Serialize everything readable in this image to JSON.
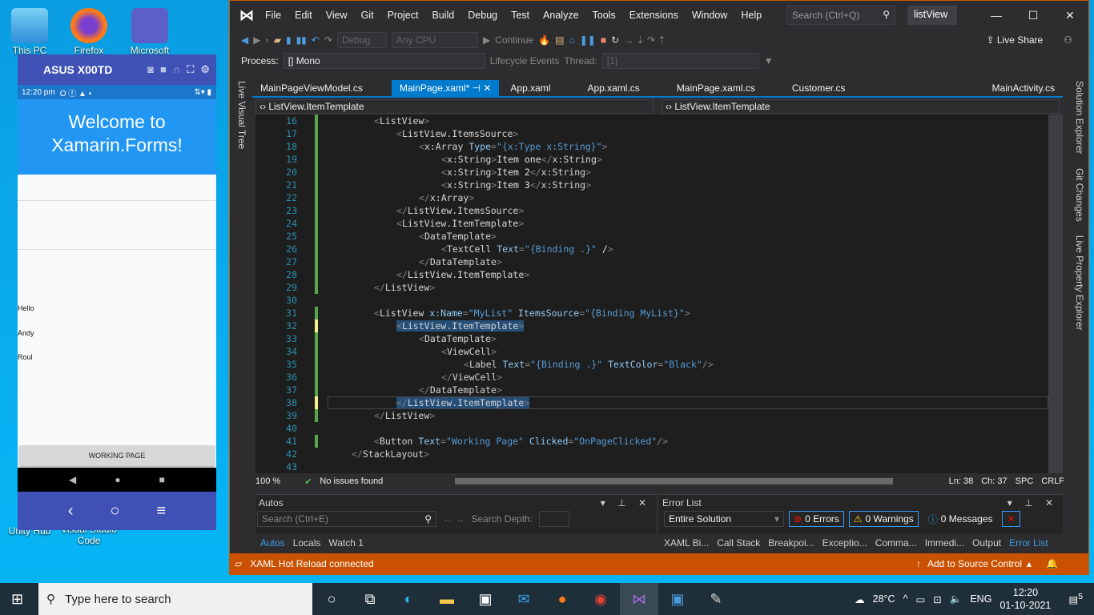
{
  "desktop": {
    "icons": [
      {
        "label": "This PC"
      },
      {
        "label": "Firefox"
      },
      {
        "label": "Microsoft"
      },
      {
        "label": "Unity Hub"
      },
      {
        "label": "Visual Studio Code"
      }
    ]
  },
  "emulator": {
    "device_name": "ASUS X00TD",
    "status_time": "12:20 pm",
    "banner_text_1": "Welcome to",
    "banner_text_2": "Xamarin.Forms!",
    "list_items": [
      "Hello",
      "Andy",
      "Roul"
    ],
    "button_label": "WORKING PAGE"
  },
  "vs": {
    "menu": [
      "File",
      "Edit",
      "View",
      "Git",
      "Project",
      "Build",
      "Debug",
      "Test",
      "Analyze",
      "Tools",
      "Extensions",
      "Window",
      "Help"
    ],
    "search_placeholder": "Search (Ctrl+Q)",
    "solution_name": "listView",
    "config": "Debug",
    "platform": "Any CPU",
    "continue_label": "Continue",
    "live_share": "Live Share",
    "process_label": "Process:",
    "process_value": "[] Mono",
    "lifecycle": "Lifecycle Events",
    "thread_label": "Thread:",
    "thread_value": "[1]",
    "tabs": [
      {
        "label": "MainPageViewModel.cs",
        "active": false
      },
      {
        "label": "MainPage.xaml*",
        "active": true
      },
      {
        "label": "App.xaml",
        "active": false
      },
      {
        "label": "App.xaml.cs",
        "active": false
      },
      {
        "label": "MainPage.xaml.cs",
        "active": false
      },
      {
        "label": "Customer.cs",
        "active": false
      },
      {
        "label": "MainActivity.cs",
        "active": false
      }
    ],
    "nav_left": "ListView.ItemTemplate",
    "nav_right": "ListView.ItemTemplate",
    "left_sidebar": "Live Visual Tree",
    "right_sidebar": [
      "Solution Explorer",
      "Git Changes",
      "Live Property Explorer"
    ],
    "code_lines": [
      {
        "n": "16",
        "text": "<ListView>"
      },
      {
        "n": "17",
        "text": "<ListView.ItemsSource>"
      },
      {
        "n": "18",
        "text": "<x:Array Type=\"{x:Type x:String}\">"
      },
      {
        "n": "19",
        "text": "<x:String>Item one</x:String>"
      },
      {
        "n": "20",
        "text": "<x:String>Item 2</x:String>"
      },
      {
        "n": "21",
        "text": "<x:String>Item 3</x:String>"
      },
      {
        "n": "22",
        "text": "</x:Array>"
      },
      {
        "n": "23",
        "text": "</ListView.ItemsSource>"
      },
      {
        "n": "24",
        "text": "<ListView.ItemTemplate>"
      },
      {
        "n": "25",
        "text": "<DataTemplate>"
      },
      {
        "n": "26",
        "text": "<TextCell Text=\"{Binding .}\" />"
      },
      {
        "n": "27",
        "text": "</DataTemplate>"
      },
      {
        "n": "28",
        "text": "</ListView.ItemTemplate>"
      },
      {
        "n": "29",
        "text": "</ListView>"
      },
      {
        "n": "30",
        "text": ""
      },
      {
        "n": "31",
        "text": "<ListView x:Name=\"MyList\" ItemsSource=\"{Binding MyList}\">"
      },
      {
        "n": "32",
        "text": "<ListView.ItemTemplate>"
      },
      {
        "n": "33",
        "text": "<DataTemplate>"
      },
      {
        "n": "34",
        "text": "<ViewCell>"
      },
      {
        "n": "35",
        "text": "<Label Text=\"{Binding .}\" TextColor=\"Black\"/>"
      },
      {
        "n": "36",
        "text": "</ViewCell>"
      },
      {
        "n": "37",
        "text": "</DataTemplate>"
      },
      {
        "n": "38",
        "text": "</ListView.ItemTemplate>"
      },
      {
        "n": "39",
        "text": "</ListView>"
      },
      {
        "n": "40",
        "text": ""
      },
      {
        "n": "41",
        "text": "<Button Text=\"Working Page\" Clicked=\"OnPageClicked\"/>"
      },
      {
        "n": "42",
        "text": "</StackLayout>"
      },
      {
        "n": "43",
        "text": ""
      }
    ],
    "zoom_level": "100 %",
    "issues": "No issues found",
    "ln": "Ln: 38",
    "ch": "Ch: 37",
    "spc": "SPC",
    "crlf": "CRLF",
    "autos": {
      "title": "Autos",
      "search_placeholder": "Search (Ctrl+E)",
      "search_depth": "Search Depth:",
      "tabs": [
        "Autos",
        "Locals",
        "Watch 1"
      ]
    },
    "error_list": {
      "title": "Error List",
      "scope": "Entire Solution",
      "errors": "0 Errors",
      "warnings": "0 Warnings",
      "messages": "0 Messages",
      "tabs": [
        "XAML Bi...",
        "Call Stack",
        "Breakpoi...",
        "Exceptio...",
        "Comma...",
        "Immedi...",
        "Output",
        "Error List"
      ]
    },
    "status_left": "XAML Hot Reload connected",
    "status_right": "Add to Source Control"
  },
  "taskbar": {
    "search_placeholder": "Type here to search",
    "weather": "28°C",
    "lang": "ENG",
    "time": "12:20",
    "date": "01-10-2021",
    "notifications": "5"
  }
}
